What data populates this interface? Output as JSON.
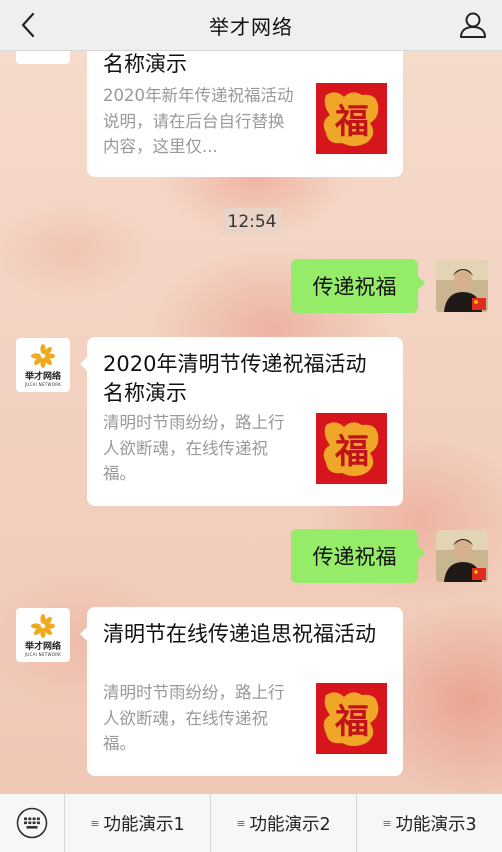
{
  "header": {
    "title": "举才网络"
  },
  "logo": {
    "name": "举才网络",
    "subtitle": "JUCAI NETWORK"
  },
  "messages": [
    {
      "type": "card",
      "title": "名称演示",
      "desc": "2020年新年传递祝福活动说明，请在后台自行替换内容，这里仅..."
    },
    {
      "type": "time",
      "text": "12:54"
    },
    {
      "type": "text",
      "text": "传递祝福"
    },
    {
      "type": "card",
      "title": "2020年清明节传递祝福活动名称演示",
      "desc": "清明时节雨纷纷，路上行人欲断魂，在线传递祝福。"
    },
    {
      "type": "text",
      "text": "传递祝福"
    },
    {
      "type": "card",
      "title": "清明节在线传递追思祝福活动",
      "desc": "清明时节雨纷纷，路上行人欲断魂，在线传递祝福。"
    }
  ],
  "thumb_text": "福",
  "menu": [
    {
      "label": "功能演示1"
    },
    {
      "label": "功能演示2"
    },
    {
      "label": "功能演示3"
    }
  ],
  "colors": {
    "bubble": "#95ec69",
    "thumb": "#d6151d",
    "gold": "#f3b72a"
  }
}
